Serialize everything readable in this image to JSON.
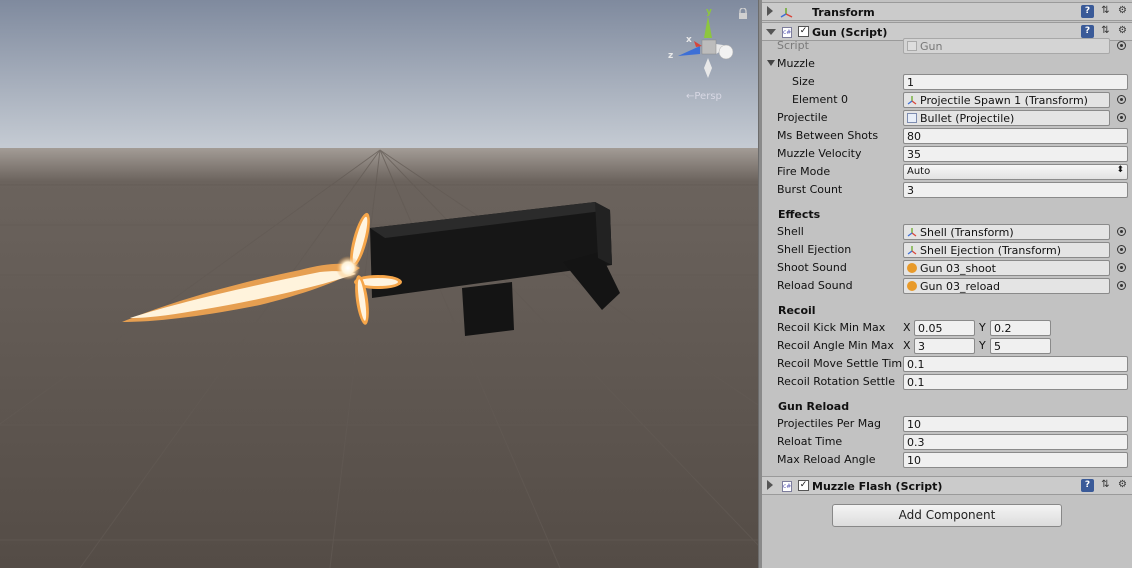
{
  "scene": {
    "view_label": "←Persp",
    "gizmo": {
      "x_label": "x",
      "y_label": "y",
      "z_label": "z"
    },
    "colors": {
      "sky": "#a9b2c0",
      "ground": "#5e5650",
      "gun": "#1a1a1a",
      "flash": "#f6a64a"
    }
  },
  "inspector": {
    "transform": {
      "title": "Transform"
    },
    "gun_script": {
      "title": "Gun (Script)",
      "script_label": "Script",
      "script_value": "Gun",
      "muzzle_label": "Muzzle",
      "size_label": "Size",
      "size_value": "1",
      "element0_label": "Element 0",
      "element0_value": "Projectile Spawn 1 (Transform)",
      "projectile_label": "Projectile",
      "projectile_value": "Bullet (Projectile)",
      "ms_between_label": "Ms Between Shots",
      "ms_between_value": "80",
      "muzzle_velocity_label": "Muzzle Velocity",
      "muzzle_velocity_value": "35",
      "fire_mode_label": "Fire Mode",
      "fire_mode_value": "Auto",
      "burst_count_label": "Burst Count",
      "burst_count_value": "3",
      "effects_header": "Effects",
      "shell_label": "Shell",
      "shell_value": "Shell (Transform)",
      "shell_ejection_label": "Shell Ejection",
      "shell_ejection_value": "Shell Ejection (Transform)",
      "shoot_sound_label": "Shoot Sound",
      "shoot_sound_value": "Gun 03_shoot",
      "reload_sound_label": "Reload Sound",
      "reload_sound_value": "Gun 03_reload",
      "recoil_header": "Recoil",
      "recoil_kick_label": "Recoil Kick Min Max",
      "recoil_kick_x": "0.05",
      "recoil_kick_y": "0.2",
      "recoil_angle_label": "Recoil Angle Min Max",
      "recoil_angle_x": "3",
      "recoil_angle_y": "5",
      "recoil_move_label": "Recoil Move Settle Tim",
      "recoil_move_value": "0.1",
      "recoil_rotation_label": "Recoil Rotation Settle",
      "recoil_rotation_value": "0.1",
      "reload_header": "Gun Reload",
      "projectiles_per_mag_label": "Projectiles Per Mag",
      "projectiles_per_mag_value": "10",
      "reload_time_label": "Reloat Time",
      "reload_time_value": "0.3",
      "max_reload_angle_label": "Max Reload Angle",
      "max_reload_angle_value": "10",
      "x_label": "X",
      "y_label": "Y"
    },
    "muzzle_flash": {
      "title": "Muzzle Flash (Script)"
    },
    "add_component_label": "Add Component"
  }
}
